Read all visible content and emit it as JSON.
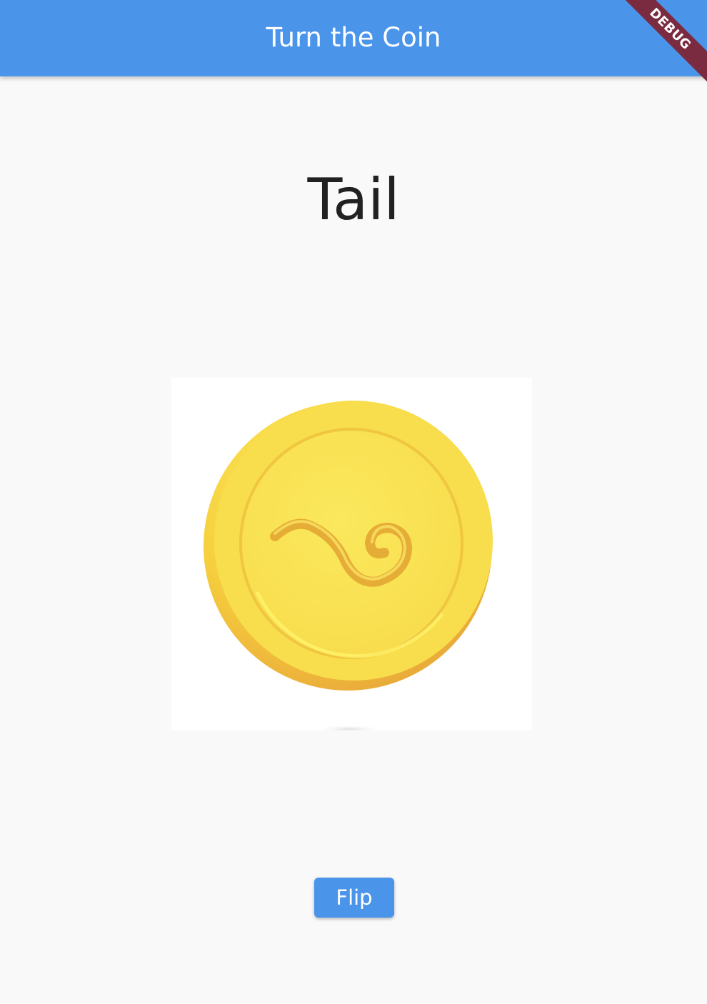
{
  "app_bar": {
    "title": "Turn the Coin",
    "color": "#4a94ea"
  },
  "debug_banner": {
    "label": "DEBUG",
    "color": "#7a2b3f"
  },
  "main": {
    "result": "Tail",
    "coin_image": {
      "side": "tail",
      "icon": "coin-tail-icon",
      "colors": {
        "face": "#f9e455",
        "edge": "#eaa43a"
      }
    },
    "flip_button": {
      "label": "Flip",
      "color": "#4a94ea"
    }
  }
}
